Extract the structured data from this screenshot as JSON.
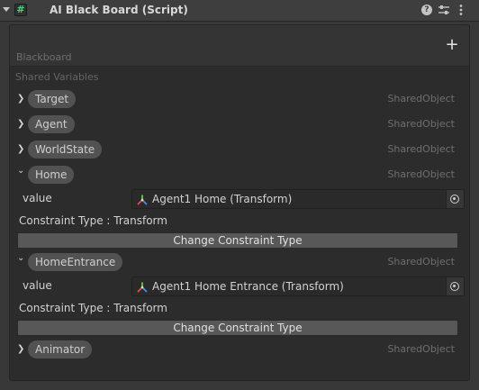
{
  "component": {
    "title": "AI Black Board (Script)",
    "script_icon": "hash-script-icon",
    "header_icons": [
      "help-icon",
      "presets-icon",
      "kebab-menu-icon"
    ]
  },
  "blackboard": {
    "title": "Blackboard",
    "add_label": "+",
    "shared_variables_label": "Shared Variables"
  },
  "variables": [
    {
      "name": "Target",
      "type": "SharedObject",
      "expanded": false
    },
    {
      "name": "Agent",
      "type": "SharedObject",
      "expanded": false
    },
    {
      "name": "WorldState",
      "type": "SharedObject",
      "expanded": false
    },
    {
      "name": "Home",
      "type": "SharedObject",
      "expanded": true,
      "value_label": "value",
      "value": "Agent1 Home (Transform)",
      "constraint": "Constraint Type : Transform",
      "button": "Change Constraint Type"
    },
    {
      "name": "HomeEntrance",
      "type": "SharedObject",
      "expanded": true,
      "value_label": "value",
      "value": "Agent1 Home Entrance (Transform)",
      "constraint": "Constraint Type : Transform",
      "button": "Change Constraint Type"
    },
    {
      "name": "Animator",
      "type": "SharedObject",
      "expanded": false
    }
  ],
  "glyphs": {
    "collapsed": "❯",
    "expanded": "⌄"
  },
  "colors": {
    "background": "#383838",
    "panel": "#2c2c2c",
    "pill": "#525252",
    "button": "#585858",
    "script_icon_accent": "#4fd07a"
  }
}
